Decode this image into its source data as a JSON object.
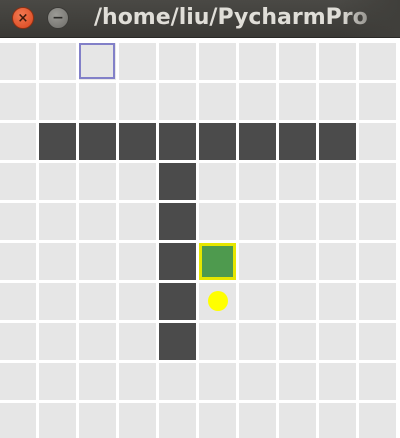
{
  "window": {
    "title": "/home/liu/PycharmPro",
    "close_symbol": "×",
    "minimize_symbol": "−",
    "close_icon": "close-icon",
    "minimize_icon": "minimize-icon"
  },
  "board": {
    "columns": 10,
    "rows": 10,
    "colors": {
      "cell": "#e6e6e6",
      "wall": "#4b4b4b",
      "agent_fill": "#4e9a4e",
      "agent_border": "#e6e600",
      "goal": "#ffff00",
      "start_marker": "#8280c8"
    },
    "walls": [
      [
        1,
        2
      ],
      [
        2,
        2
      ],
      [
        3,
        2
      ],
      [
        4,
        2
      ],
      [
        5,
        2
      ],
      [
        6,
        2
      ],
      [
        7,
        2
      ],
      [
        8,
        2
      ],
      [
        4,
        3
      ],
      [
        4,
        4
      ],
      [
        4,
        5
      ],
      [
        4,
        6
      ],
      [
        4,
        7
      ]
    ],
    "start_cell": [
      2,
      0
    ],
    "agent_cell": [
      5,
      5
    ],
    "goal_cell": [
      5,
      6
    ]
  }
}
